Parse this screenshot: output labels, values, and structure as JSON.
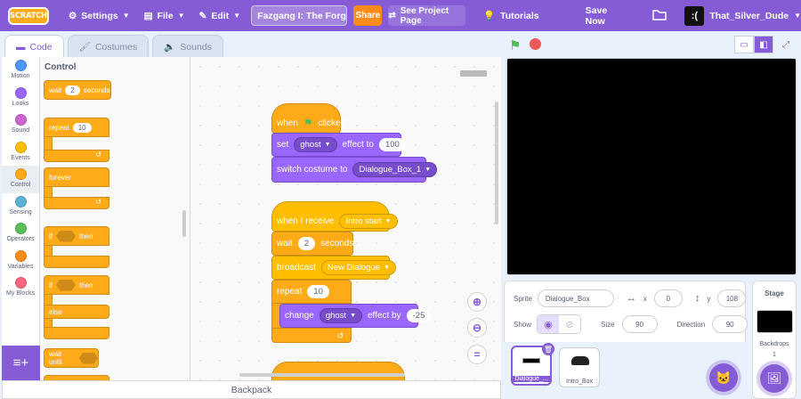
{
  "menubar": {
    "logo": "SCRATCH",
    "settings": "Settings",
    "file": "File",
    "edit": "Edit",
    "project_title": "Fazgang I: The Forgotten ...",
    "share": "Share",
    "see_project_page": "See Project Page",
    "tutorials": "Tutorials",
    "save_now": "Save Now",
    "user": "That_Silver_Dude"
  },
  "tabs": {
    "code": "Code",
    "costumes": "Costumes",
    "sounds": "Sounds"
  },
  "categories": [
    {
      "label": "Motion",
      "color": "#4c97ff"
    },
    {
      "label": "Looks",
      "color": "#9966ff"
    },
    {
      "label": "Sound",
      "color": "#cf63cf"
    },
    {
      "label": "Events",
      "color": "#ffbf00"
    },
    {
      "label": "Control",
      "color": "#ffab19"
    },
    {
      "label": "Sensing",
      "color": "#5cb1d6"
    },
    {
      "label": "Operators",
      "color": "#59c059"
    },
    {
      "label": "Variables",
      "color": "#ff8c1a"
    },
    {
      "label": "My Blocks",
      "color": "#ff6680"
    }
  ],
  "palette": {
    "title": "Control",
    "wait": "wait",
    "wait_value": "2",
    "seconds": "seconds",
    "repeat": "repeat",
    "repeat_value": "10",
    "forever": "forever",
    "if1": "if",
    "then1": "then",
    "if2": "if",
    "then2": "then",
    "else": "else",
    "wait_until": "wait until"
  },
  "script": {
    "hat1": {
      "when": "when",
      "clicked": "clicked"
    },
    "set_effect": {
      "set": "set",
      "effect": "ghost",
      "effect_to": "effect to",
      "value": "100"
    },
    "switch_costume": {
      "label": "switch costume to",
      "costume": "Dialogue_Box_1"
    },
    "hat2": {
      "label": "when I receive",
      "message": "Intro start"
    },
    "wait": {
      "label": "wait",
      "value": "2",
      "unit": "seconds"
    },
    "broadcast": {
      "label": "broadcast",
      "message": "New Dialogue"
    },
    "repeat": {
      "label": "repeat",
      "value": "10"
    },
    "change_effect": {
      "label": "change",
      "effect": "ghost",
      "effect_by": "effect by",
      "value": "-25"
    }
  },
  "backpack": "Backpack",
  "sprite_info": {
    "sprite_label": "Sprite",
    "sprite_name": "Dialogue_Box",
    "x_label": "x",
    "x": "0",
    "y_label": "y",
    "y": "108",
    "show_label": "Show",
    "size_label": "Size",
    "size": "90",
    "direction_label": "Direction",
    "direction": "90"
  },
  "sprites": [
    {
      "name": "Dialogue_..."
    },
    {
      "name": "Intro_Box"
    }
  ],
  "stage_target": {
    "title": "Stage",
    "backdrops_label": "Backdrops",
    "backdrops_count": "1"
  }
}
